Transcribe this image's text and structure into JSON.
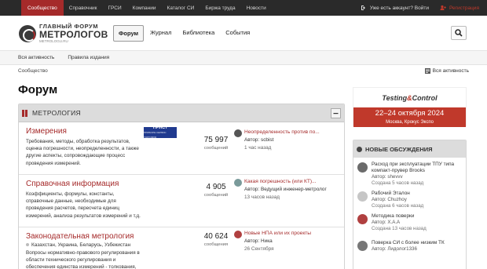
{
  "topnav": {
    "items": [
      "Сообщество",
      "Справочник",
      "ГРСИ",
      "Компании",
      "Каталог СИ",
      "Биржа труда",
      "Новости"
    ],
    "login": "Уже есть аккаунт? Войти",
    "register": "Регистрация"
  },
  "logo": {
    "line1": "ГЛАВНЫЙ ФОРУМ",
    "line2": "МЕТРОЛОГОВ",
    "line3": "METROLOGU.RU"
  },
  "mainnav": [
    "Форум",
    "Журнал",
    "Библиотека",
    "События"
  ],
  "subnav": [
    "Вся активность",
    "Правила издания"
  ],
  "breadcrumb": "Сообщество",
  "all_activity": "Вся активность",
  "page_title": "Форум",
  "category": {
    "title": "МЕТРОЛОГИЯ",
    "nodes": [
      {
        "name": "Измерения",
        "desc": "Требования, методы, обработка результатов, оценка погрешности, неопределенности, а также другие аспекты, сопровождающие процесс проведения измерений.",
        "sponsor": "ПРИСТ",
        "sponsor_sub": "ПРИБОРЫ СЕРВИС ТОРГОВЛЯ",
        "count": "75 997",
        "count_label": "сообщений",
        "last_title": "Неопределенность против по...",
        "last_author": "Автор: scbist",
        "last_time": "1 час назад"
      },
      {
        "name": "Справочная информация",
        "desc": "Коэффициенты, формулы, константы, справочные данные, необходимые для проведения расчетов, пересчета единиц измерений, анализа результатов измерений и т.д.",
        "count": "4 905",
        "count_label": "сообщений",
        "last_title": "Какая погрешность (или КТ)...",
        "last_author": "Автор: Ведущий инженер-метролог",
        "last_time": "13 часов назад"
      },
      {
        "name": "Законодательная метрология",
        "tags": [
          "Казахстан",
          "Украина",
          "Беларусь",
          "Узбекистан"
        ],
        "desc": "Вопросы нормативно-правового регулирования в области технического регулирования и обеспечения единства измерений - толкования, разъяснения...",
        "count": "40 624",
        "count_label": "сообщения",
        "last_title": "Новые НПА или их проекты",
        "last_author": "Автор: Ника",
        "last_time": "26 Сентября"
      }
    ]
  },
  "ad": {
    "brand1": "Testing",
    "brand_amp": "&",
    "brand2": "Control",
    "dates": "22–24 октября 2024",
    "place": "Москва, Крокус Экспо"
  },
  "sidebar": {
    "title": "НОВЫЕ ОБСУЖДЕНИЯ",
    "items": [
      {
        "title": "Расход при эксплуатации ТПУ типа компакт-прувер Brooks",
        "author": "Автор: shevvv",
        "date": "Создана 5 часов назад"
      },
      {
        "title": "Рабочий Эталон",
        "author": "Автор: Chuzhoy",
        "date": "Создана 6 часов назад"
      },
      {
        "title": "Методика поверки",
        "author": "Автор: Х.А.А",
        "date": "Создана 13 часов назад"
      },
      {
        "title": "Поверка СИ с более низким ТК",
        "author": "Автор: Лидолог1336",
        "date": ""
      }
    ]
  },
  "colors": {
    "accent": "#a52a2a",
    "topbar": "#2a2a2a",
    "ad_red": "#c0392b"
  }
}
